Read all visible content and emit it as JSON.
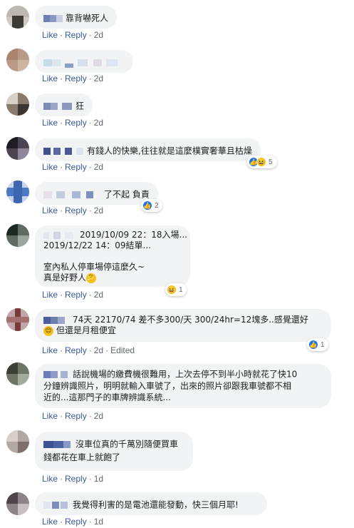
{
  "actions": {
    "like": "Like",
    "reply": "Reply",
    "edited": "Edited"
  },
  "comments": [
    {
      "text": "靠背嚇死人",
      "time": "2d"
    },
    {
      "text": "",
      "time": "2d"
    },
    {
      "text": "狂",
      "time": "2d"
    },
    {
      "text": "有錢人的快樂,往往就是這麼樸實奢華且枯燥",
      "time": "2d",
      "reactions": "5"
    },
    {
      "text": "了不起 負責",
      "time": "2d",
      "reactions": "2"
    },
    {
      "lines": [
        "2019/10/09 22：18入場...",
        "2019/12/22 14：09結單...",
        "",
        "室內私人停車場停這麼久~",
        "真是好野人"
      ],
      "time": "2d",
      "reactions": "1"
    },
    {
      "lines": [
        "74天 22170/74 差不多300/天 300/24hr=12塊多..感覺還好",
        "但還是月租便宜"
      ],
      "time": "2d",
      "reactions": "1",
      "edited": true
    },
    {
      "lines": [
        "話說機場的繳費機很難用，上次去停不到半小時就花了快10",
        "分鐘辨識照片，明明就輸入車號了，出來的照片卻跟我車號都不相",
        "近的...這那門子的車牌辨識系統..."
      ],
      "time": "2d"
    },
    {
      "lines": [
        "沒車位真的千萬別隨便買車",
        "錢都花在車上就飽了"
      ],
      "time": "1d"
    },
    {
      "text": "我覺得利害的是電池還能發動，快三個月耶!",
      "time": "1d"
    }
  ]
}
